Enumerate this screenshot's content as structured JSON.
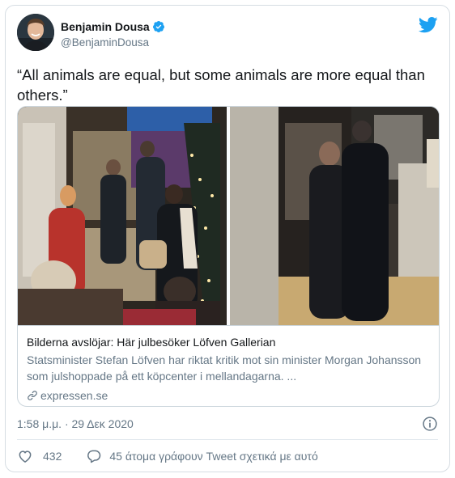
{
  "author": {
    "display_name": "Benjamin Dousa",
    "handle": "@BenjaminDousa",
    "verified": true
  },
  "tweet": {
    "text": "“All animals are equal, but some animals are more equal than others.”"
  },
  "link_card": {
    "title": "Bilderna avslöjar: Här julbesöker Löfven Gallerian",
    "description": "Statsminister Stefan Löfven har riktat kritik mot sin minister Morgan Johansson som julshoppade på ett köpcenter i mellandagarna. ...",
    "domain": "expressen.se"
  },
  "meta": {
    "timestamp": "1:58 μ.μ. · 29 Δεκ 2020"
  },
  "actions": {
    "like_count": "432",
    "talking_text": "45 άτομα γράφουν Tweet σχετικά με αυτό"
  },
  "colors": {
    "twitter_blue": "#1da1f2",
    "secondary_text": "#657786",
    "primary_text": "#14171a",
    "border": "#ccd6dd"
  },
  "icons": {
    "verified": "verified-badge-icon",
    "logo": "twitter-bird-icon",
    "link": "link-chain-icon",
    "info": "info-circle-icon",
    "like": "heart-outline-icon",
    "reply": "speech-bubble-icon"
  }
}
